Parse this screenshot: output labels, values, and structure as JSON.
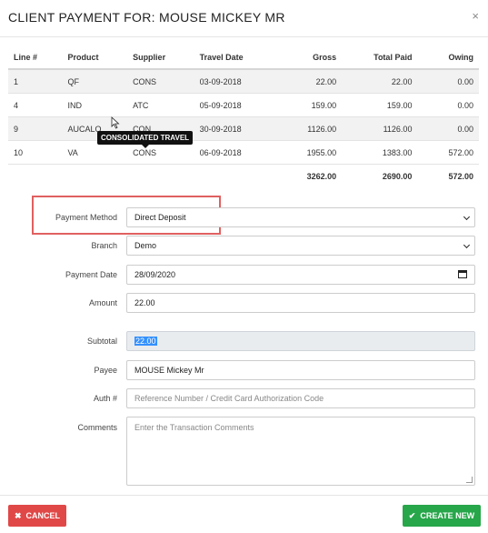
{
  "modal": {
    "title": "CLIENT PAYMENT FOR: MOUSE MICKEY MR",
    "close_glyph": "×"
  },
  "table": {
    "headers": [
      "Line #",
      "Product",
      "Supplier",
      "Travel Date",
      "Gross",
      "Total Paid",
      "Owing"
    ],
    "rows": [
      [
        "1",
        "QF",
        "CONS",
        "03-09-2018",
        "22.00",
        "22.00",
        "0.00"
      ],
      [
        "4",
        "IND",
        "ATC",
        "05-09-2018",
        "159.00",
        "159.00",
        "0.00"
      ],
      [
        "9",
        "AUCALO",
        "CON",
        "30-09-2018",
        "1126.00",
        "1126.00",
        "0.00"
      ],
      [
        "10",
        "VA",
        "CONS",
        "06-09-2018",
        "1955.00",
        "1383.00",
        "572.00"
      ]
    ],
    "totals": {
      "gross": "3262.00",
      "total_paid": "2690.00",
      "owing": "572.00"
    }
  },
  "tooltip": "CONSOLIDATED TRAVEL",
  "form": {
    "payment_method": {
      "label": "Payment Method",
      "value": "Direct Deposit"
    },
    "branch": {
      "label": "Branch",
      "value": "Demo"
    },
    "payment_date": {
      "label": "Payment Date",
      "value": "28/09/2020"
    },
    "amount": {
      "label": "Amount",
      "value": "22.00"
    },
    "subtotal": {
      "label": "Subtotal",
      "value": "22.00"
    },
    "payee": {
      "label": "Payee",
      "value": "MOUSE Mickey Mr"
    },
    "auth": {
      "label": "Auth #",
      "placeholder": "Reference Number / Credit Card Authorization Code"
    },
    "comments": {
      "label": "Comments",
      "placeholder": "Enter the Transaction Comments"
    }
  },
  "buttons": {
    "cancel": "CANCEL",
    "create": "CREATE NEW"
  },
  "colors": {
    "cancel": "#e04848",
    "create": "#27a64a",
    "highlight": "#e06060"
  }
}
